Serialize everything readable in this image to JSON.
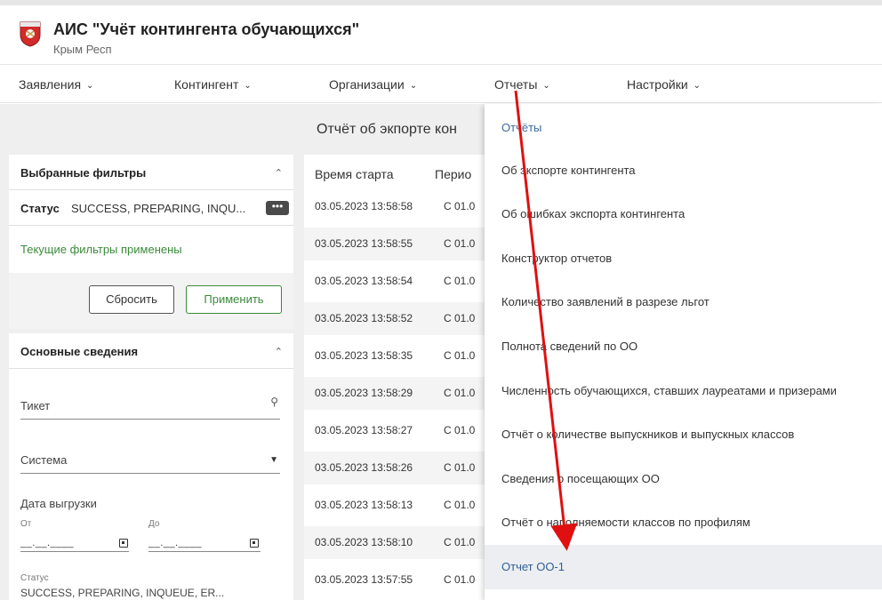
{
  "app": {
    "title": "АИС \"Учёт контингента обучающихся\"",
    "subtitle": "Крым Респ"
  },
  "nav": [
    {
      "label": "Заявления"
    },
    {
      "label": "Контингент"
    },
    {
      "label": "Организации"
    },
    {
      "label": "Отчеты"
    },
    {
      "label": "Настройки"
    }
  ],
  "page": {
    "heading": "Отчёт об экпорте кон"
  },
  "filters": {
    "title": "Выбранные фильтры",
    "status_label": "Статус",
    "status_value": "SUCCESS, PREPARING, INQU...",
    "tag_icon": "more-dots-icon",
    "applied_text": "Текущие фильтры применены",
    "reset_label": "Сбросить",
    "apply_label": "Применить"
  },
  "info": {
    "title": "Основные сведения",
    "ticket_label": "Тикет",
    "system_label": "Система",
    "date_label": "Дата выгрузки",
    "from_label": "От",
    "to_label": "До",
    "date_mask": "__.__.____",
    "status_label": "Статус",
    "status_value": "SUCCESS, PREPARING, INQUEUE, ER..."
  },
  "table": {
    "headers": [
      "Время старта",
      "Перио"
    ],
    "rows": [
      {
        "time": "03.05.2023 13:58:58",
        "period": "С 01.0"
      },
      {
        "time": "03.05.2023 13:58:55",
        "period": "С 01.0"
      },
      {
        "time": "03.05.2023 13:58:54",
        "period": "С 01.0"
      },
      {
        "time": "03.05.2023 13:58:52",
        "period": "С 01.0"
      },
      {
        "time": "03.05.2023 13:58:35",
        "period": "С 01.0"
      },
      {
        "time": "03.05.2023 13:58:29",
        "period": "С 01.0"
      },
      {
        "time": "03.05.2023 13:58:27",
        "period": "С 01.0"
      },
      {
        "time": "03.05.2023 13:58:26",
        "period": "С 01.0"
      },
      {
        "time": "03.05.2023 13:58:13",
        "period": "С 01.0"
      },
      {
        "time": "03.05.2023 13:58:10",
        "period": "С 01.0"
      },
      {
        "time": "03.05.2023 13:57:55",
        "period": "С 01.0"
      }
    ]
  },
  "reports_menu": [
    {
      "label": "Отчёты"
    },
    {
      "label": "Об экспорте контингента"
    },
    {
      "label": "Об ошибках экспорта контингента"
    },
    {
      "label": "Конструктор отчетов"
    },
    {
      "label": "Количество заявлений в разрезе льгот"
    },
    {
      "label": "Полнота сведений по ОО"
    },
    {
      "label": "Численность обучающихся, ставших лауреатами и призерами"
    },
    {
      "label": "Отчёт о количестве выпускников и выпускных классов"
    },
    {
      "label": "Сведения о посещающих ОО"
    },
    {
      "label": "Отчёт о наполняемости классов по профилям"
    },
    {
      "label": "Отчет ОО-1"
    }
  ],
  "colors": {
    "accent_green": "#3a8a3a",
    "link_blue": "#3a6aa0",
    "annotation_red": "#e01010",
    "highlight_bg": "#eceef1"
  }
}
